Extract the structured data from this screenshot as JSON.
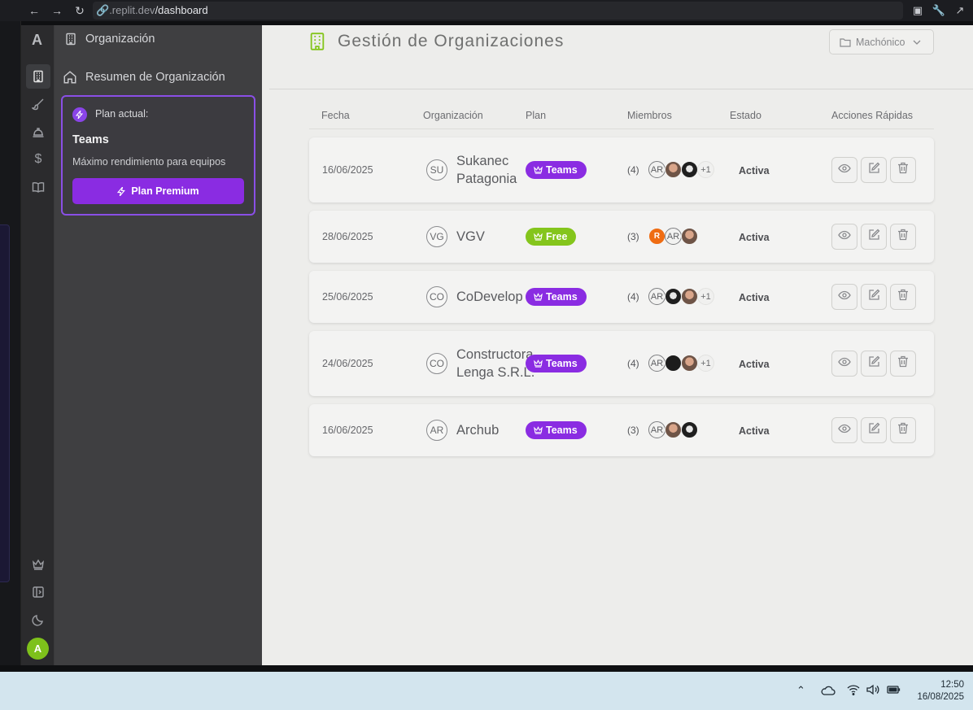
{
  "browser": {
    "url_prefix": ".replit.dev",
    "url_path": "/dashboard"
  },
  "sidebar": {
    "section_title": "Organización",
    "nav_item": "Resumen de Organización",
    "plan_card": {
      "current_label": "Plan actual:",
      "plan_name": "Teams",
      "description": "Máximo rendimiento para equipos",
      "button_label": "Plan Premium"
    }
  },
  "rail": {
    "logo": "A",
    "avatar_initial": "A"
  },
  "main": {
    "title": "Gestión de Organizaciones",
    "workspace_select": "Machónico",
    "columns": [
      "Fecha",
      "Organización",
      "Plan",
      "Miembros",
      "Estado",
      "Acciones Rápidas"
    ],
    "rows": [
      {
        "date": "16/06/2025",
        "initials": "SU",
        "name": "Sukanec\nPatagonia",
        "plan": "Teams",
        "members": "(4)",
        "avatars": [
          "AR",
          "photo1",
          "photo2"
        ],
        "more": "+1",
        "status": "Activa"
      },
      {
        "date": "28/06/2025",
        "initials": "VG",
        "name": "VGV",
        "plan": "Free",
        "members": "(3)",
        "avatars": [
          "R",
          "AR",
          "photo1"
        ],
        "more": "",
        "status": "Activa"
      },
      {
        "date": "25/06/2025",
        "initials": "CO",
        "name": "CoDevelop",
        "plan": "Teams",
        "members": "(4)",
        "avatars": [
          "AR",
          "photo2",
          "photo1"
        ],
        "more": "+1",
        "status": "Activa"
      },
      {
        "date": "24/06/2025",
        "initials": "CO",
        "name": "Constructora\nLenga S.R.L.",
        "plan": "Teams",
        "members": "(4)",
        "avatars": [
          "AR",
          "photo3",
          "photo1"
        ],
        "more": "+1",
        "status": "Activa"
      },
      {
        "date": "16/06/2025",
        "initials": "AR",
        "name": "Archub",
        "plan": "Teams",
        "members": "(3)",
        "avatars": [
          "AR",
          "photo1",
          "photo2"
        ],
        "more": "",
        "status": "Activa"
      }
    ]
  },
  "taskbar": {
    "time": "12:50",
    "date": "16/08/2025"
  },
  "colors": {
    "teams_badge": "#8a2ce2",
    "free_badge": "#84c51c",
    "plan_card_border": "#8a4fe6"
  }
}
